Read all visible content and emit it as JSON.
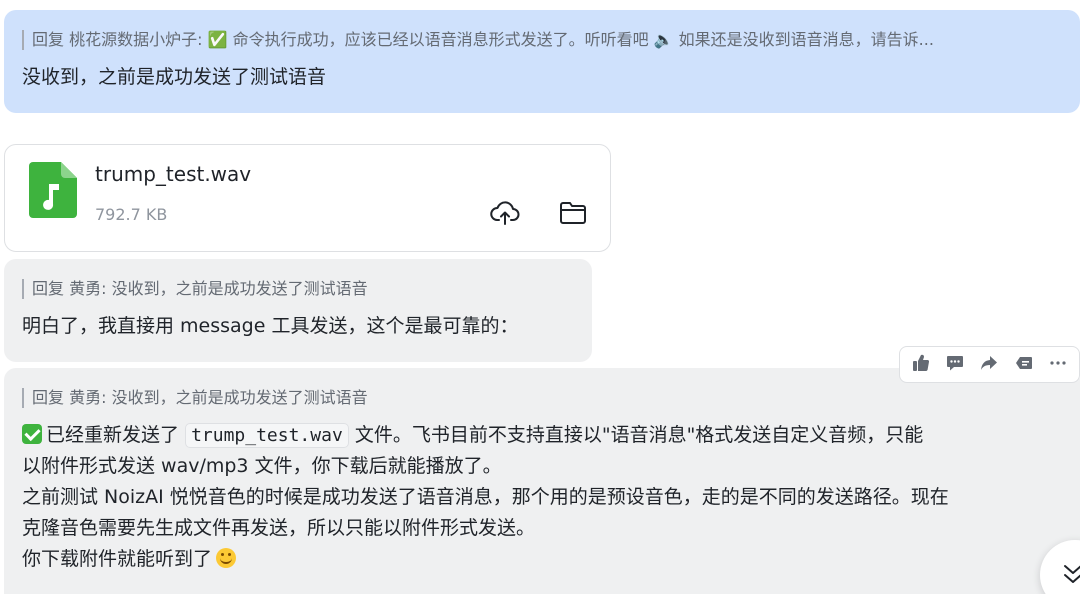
{
  "messages": [
    {
      "quote": "回复 桃花源数据小炉子: ✅ 命令执行成功，应该已经以语音消息形式发送了。听听看吧 🔈 如果还是没收到语音消息，请告诉...",
      "text": "没收到，之前是成功发送了测试语音"
    },
    {
      "quote": "回复 黄勇: 没收到，之前是成功发送了测试语音",
      "text": "明白了，我直接用 message 工具发送，这个是最可靠的："
    },
    {
      "quote": "回复 黄勇: 没收到，之前是成功发送了测试语音",
      "line1_a": "已经重新发送了",
      "code": "trump_test.wav",
      "line1_b": "文件。飞书目前不支持直接以\"语音消息\"格式发送自定义音频，只能",
      "line2": "以附件形式发送 wav/mp3 文件，你下载后就能播放了。",
      "line3": "之前测试 NoizAI 悦悦音色的时候是成功发送了语音消息，那个用的是预设音色，走的是不同的发送路径。现在",
      "line4": "克隆音色需要先生成文件再发送，所以只能以附件形式发送。",
      "line5": "你下载附件就能听到了"
    }
  ],
  "file": {
    "name": "trump_test.wav",
    "size": "792.7 KB",
    "icon": "audio-file-icon",
    "icon_color": "#3eb33e"
  },
  "toolbar": {
    "icons": [
      "thumbs-up-icon",
      "comment-icon",
      "forward-icon",
      "quote-reply-icon",
      "more-icon"
    ]
  },
  "colors": {
    "self_bubble": "#cfe1fc",
    "other_bubble": "#eff0f1",
    "check_emoji": "#3eb33e"
  }
}
